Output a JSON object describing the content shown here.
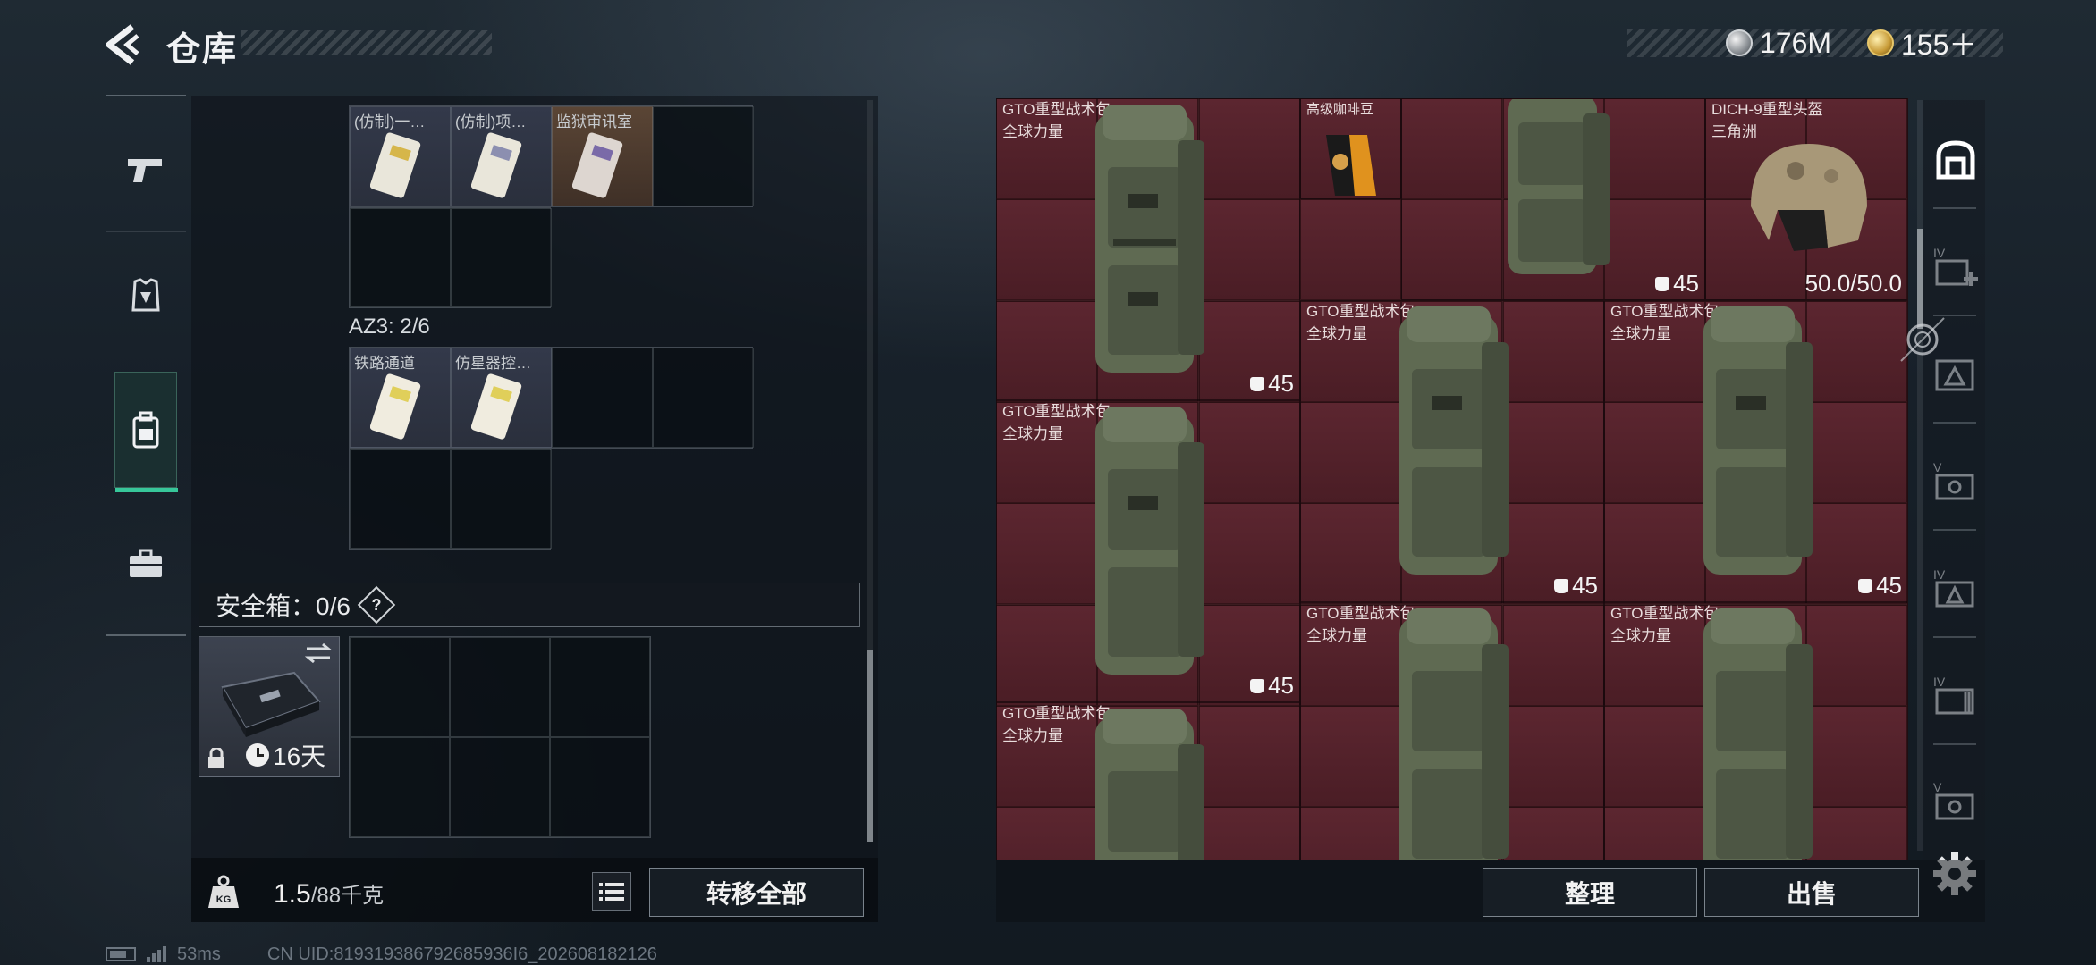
{
  "header": {
    "title": "仓库",
    "currencies": [
      {
        "icon": "silver-coin-icon",
        "value": "176M"
      },
      {
        "icon": "gold-coin-icon",
        "value": "155＋"
      }
    ]
  },
  "side_nav": {
    "items": [
      {
        "icon": "pistol-icon",
        "active": false
      },
      {
        "icon": "armor-icon",
        "active": false
      },
      {
        "icon": "backpack-icon",
        "active": true
      },
      {
        "icon": "briefcase-icon",
        "active": false
      }
    ]
  },
  "left_panel": {
    "keycard_grid_top": [
      {
        "label": "(仿制)一…",
        "icon": "keycard-icon"
      },
      {
        "label": "(仿制)项…",
        "icon": "keycard-icon"
      },
      {
        "label": "监狱审讯室",
        "icon": "keycard-icon"
      }
    ],
    "az3_label": "AZ3: 2/6",
    "keycard_grid_az3": [
      {
        "label": "铁路通道",
        "icon": "keycard-icon"
      },
      {
        "label": "仿星器控…",
        "icon": "keycard-icon"
      }
    ],
    "safe_box": {
      "label": "安全箱：0/6",
      "help": "?",
      "timer": "16天"
    },
    "weight": {
      "current": "1.5",
      "max": "/88千克"
    },
    "transfer_all_label": "转移全部"
  },
  "stash": {
    "items": [
      {
        "name": "GTO重型战术包",
        "sub": "全球力量",
        "count": "45",
        "kind": "backpack"
      },
      {
        "name": "高级咖啡豆",
        "sub": "",
        "count": "",
        "kind": "coffee"
      },
      {
        "name": "",
        "sub": "",
        "count": "45",
        "kind": "backpack"
      },
      {
        "name": "DICH-9重型头盔",
        "sub": "三角洲",
        "durability": "50.0/50.0",
        "kind": "helmet"
      },
      {
        "name": "GTO重型战术包",
        "sub": "全球力量",
        "count": "45",
        "kind": "backpack"
      },
      {
        "name": "GTO重型战术包",
        "sub": "全球力量",
        "count": "45",
        "kind": "backpack"
      },
      {
        "name": "GTO重型战术包",
        "sub": "全球力量",
        "count": "45",
        "kind": "backpack"
      },
      {
        "name": "GTO重型战术包",
        "sub": "全球力量",
        "count": "",
        "kind": "backpack"
      },
      {
        "name": "GTO重型战术包",
        "sub": "全球力量",
        "count": "",
        "kind": "backpack"
      },
      {
        "name": "GTO重型战术包",
        "sub": "全球力量",
        "count": "",
        "kind": "backpack"
      }
    ],
    "sort_label": "整理",
    "sell_label": "出售"
  },
  "right_rail": {
    "items": [
      {
        "icon": "stash-home-icon",
        "active": true
      },
      {
        "icon": "stash-tab-4-add-icon",
        "roman": "IV"
      },
      {
        "icon": "stash-tab-triangle-icon",
        "roman": ""
      },
      {
        "icon": "stash-tab-5-icon",
        "roman": "V"
      },
      {
        "icon": "stash-tab-4-triangle-icon",
        "roman": "IV"
      },
      {
        "icon": "stash-tab-4-folder-icon",
        "roman": "IV"
      },
      {
        "icon": "stash-tab-5-card-icon",
        "roman": "V"
      }
    ]
  },
  "footer": {
    "ping": "53ms",
    "uid": "CN UID:819319386792685936I6_202608182126"
  },
  "colors": {
    "stash_bg": "#4a1d25",
    "accent_green": "#37c79a",
    "panel_bg": "#0e141a"
  }
}
